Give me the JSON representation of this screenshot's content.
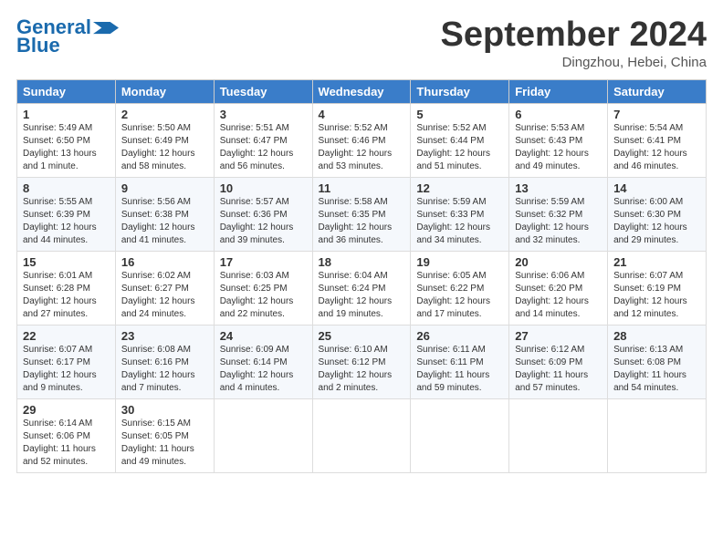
{
  "header": {
    "logo_line1": "General",
    "logo_line2": "Blue",
    "month": "September 2024",
    "location": "Dingzhou, Hebei, China"
  },
  "weekdays": [
    "Sunday",
    "Monday",
    "Tuesday",
    "Wednesday",
    "Thursday",
    "Friday",
    "Saturday"
  ],
  "weeks": [
    [
      {
        "day": "1",
        "text": "Sunrise: 5:49 AM\nSunset: 6:50 PM\nDaylight: 13 hours\nand 1 minute."
      },
      {
        "day": "2",
        "text": "Sunrise: 5:50 AM\nSunset: 6:49 PM\nDaylight: 12 hours\nand 58 minutes."
      },
      {
        "day": "3",
        "text": "Sunrise: 5:51 AM\nSunset: 6:47 PM\nDaylight: 12 hours\nand 56 minutes."
      },
      {
        "day": "4",
        "text": "Sunrise: 5:52 AM\nSunset: 6:46 PM\nDaylight: 12 hours\nand 53 minutes."
      },
      {
        "day": "5",
        "text": "Sunrise: 5:52 AM\nSunset: 6:44 PM\nDaylight: 12 hours\nand 51 minutes."
      },
      {
        "day": "6",
        "text": "Sunrise: 5:53 AM\nSunset: 6:43 PM\nDaylight: 12 hours\nand 49 minutes."
      },
      {
        "day": "7",
        "text": "Sunrise: 5:54 AM\nSunset: 6:41 PM\nDaylight: 12 hours\nand 46 minutes."
      }
    ],
    [
      {
        "day": "8",
        "text": "Sunrise: 5:55 AM\nSunset: 6:39 PM\nDaylight: 12 hours\nand 44 minutes."
      },
      {
        "day": "9",
        "text": "Sunrise: 5:56 AM\nSunset: 6:38 PM\nDaylight: 12 hours\nand 41 minutes."
      },
      {
        "day": "10",
        "text": "Sunrise: 5:57 AM\nSunset: 6:36 PM\nDaylight: 12 hours\nand 39 minutes."
      },
      {
        "day": "11",
        "text": "Sunrise: 5:58 AM\nSunset: 6:35 PM\nDaylight: 12 hours\nand 36 minutes."
      },
      {
        "day": "12",
        "text": "Sunrise: 5:59 AM\nSunset: 6:33 PM\nDaylight: 12 hours\nand 34 minutes."
      },
      {
        "day": "13",
        "text": "Sunrise: 5:59 AM\nSunset: 6:32 PM\nDaylight: 12 hours\nand 32 minutes."
      },
      {
        "day": "14",
        "text": "Sunrise: 6:00 AM\nSunset: 6:30 PM\nDaylight: 12 hours\nand 29 minutes."
      }
    ],
    [
      {
        "day": "15",
        "text": "Sunrise: 6:01 AM\nSunset: 6:28 PM\nDaylight: 12 hours\nand 27 minutes."
      },
      {
        "day": "16",
        "text": "Sunrise: 6:02 AM\nSunset: 6:27 PM\nDaylight: 12 hours\nand 24 minutes."
      },
      {
        "day": "17",
        "text": "Sunrise: 6:03 AM\nSunset: 6:25 PM\nDaylight: 12 hours\nand 22 minutes."
      },
      {
        "day": "18",
        "text": "Sunrise: 6:04 AM\nSunset: 6:24 PM\nDaylight: 12 hours\nand 19 minutes."
      },
      {
        "day": "19",
        "text": "Sunrise: 6:05 AM\nSunset: 6:22 PM\nDaylight: 12 hours\nand 17 minutes."
      },
      {
        "day": "20",
        "text": "Sunrise: 6:06 AM\nSunset: 6:20 PM\nDaylight: 12 hours\nand 14 minutes."
      },
      {
        "day": "21",
        "text": "Sunrise: 6:07 AM\nSunset: 6:19 PM\nDaylight: 12 hours\nand 12 minutes."
      }
    ],
    [
      {
        "day": "22",
        "text": "Sunrise: 6:07 AM\nSunset: 6:17 PM\nDaylight: 12 hours\nand 9 minutes."
      },
      {
        "day": "23",
        "text": "Sunrise: 6:08 AM\nSunset: 6:16 PM\nDaylight: 12 hours\nand 7 minutes."
      },
      {
        "day": "24",
        "text": "Sunrise: 6:09 AM\nSunset: 6:14 PM\nDaylight: 12 hours\nand 4 minutes."
      },
      {
        "day": "25",
        "text": "Sunrise: 6:10 AM\nSunset: 6:12 PM\nDaylight: 12 hours\nand 2 minutes."
      },
      {
        "day": "26",
        "text": "Sunrise: 6:11 AM\nSunset: 6:11 PM\nDaylight: 11 hours\nand 59 minutes."
      },
      {
        "day": "27",
        "text": "Sunrise: 6:12 AM\nSunset: 6:09 PM\nDaylight: 11 hours\nand 57 minutes."
      },
      {
        "day": "28",
        "text": "Sunrise: 6:13 AM\nSunset: 6:08 PM\nDaylight: 11 hours\nand 54 minutes."
      }
    ],
    [
      {
        "day": "29",
        "text": "Sunrise: 6:14 AM\nSunset: 6:06 PM\nDaylight: 11 hours\nand 52 minutes."
      },
      {
        "day": "30",
        "text": "Sunrise: 6:15 AM\nSunset: 6:05 PM\nDaylight: 11 hours\nand 49 minutes."
      },
      {
        "day": "",
        "text": ""
      },
      {
        "day": "",
        "text": ""
      },
      {
        "day": "",
        "text": ""
      },
      {
        "day": "",
        "text": ""
      },
      {
        "day": "",
        "text": ""
      }
    ]
  ]
}
